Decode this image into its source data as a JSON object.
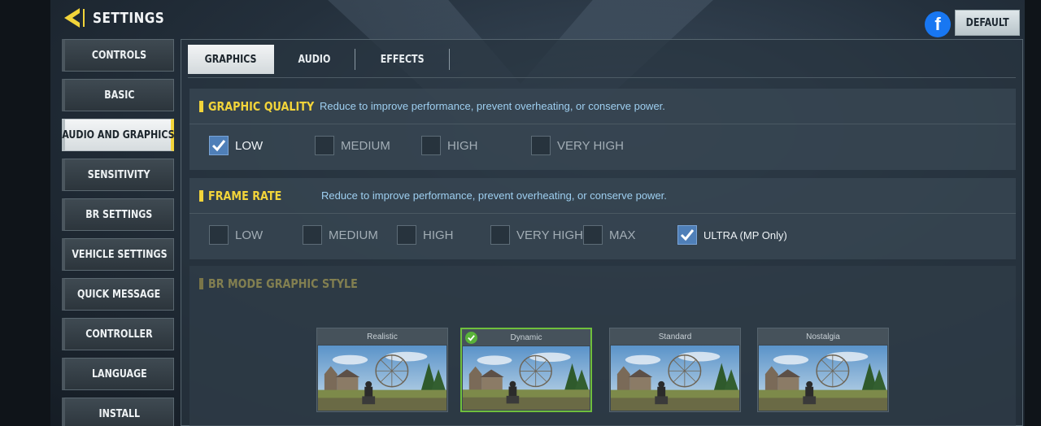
{
  "header": {
    "title": "SETTINGS",
    "back_icon": "back-arrow-icon",
    "default_label": "DEFAULT",
    "facebook_icon": "facebook-icon"
  },
  "sidebar": {
    "items": [
      {
        "label": "CONTROLS"
      },
      {
        "label": "BASIC"
      },
      {
        "label": "AUDIO AND GRAPHICS",
        "active": true
      },
      {
        "label": "SENSITIVITY"
      },
      {
        "label": "BR SETTINGS"
      },
      {
        "label": "VEHICLE SETTINGS"
      },
      {
        "label": "QUICK MESSAGE"
      },
      {
        "label": "CONTROLLER"
      },
      {
        "label": "LANGUAGE"
      },
      {
        "label": "INSTALL"
      }
    ]
  },
  "tabs": [
    {
      "label": "GRAPHICS",
      "active": true
    },
    {
      "label": "AUDIO"
    },
    {
      "label": "EFFECTS"
    }
  ],
  "graphic_quality": {
    "title": "GRAPHIC QUALITY",
    "description": "Reduce to improve performance, prevent overheating, or conserve power.",
    "options": [
      {
        "label": "LOW",
        "checked": true
      },
      {
        "label": "MEDIUM",
        "checked": false
      },
      {
        "label": "HIGH",
        "checked": false
      },
      {
        "label": "VERY HIGH",
        "checked": false
      }
    ]
  },
  "frame_rate": {
    "title": "FRAME RATE",
    "description": "Reduce to improve performance, prevent overheating, or conserve power.",
    "options": [
      {
        "label": "LOW",
        "checked": false
      },
      {
        "label": "MEDIUM",
        "checked": false
      },
      {
        "label": "HIGH",
        "checked": false
      },
      {
        "label": "VERY HIGH",
        "checked": false
      },
      {
        "label": "MAX",
        "checked": false
      },
      {
        "label": "ULTRA (MP Only)",
        "checked": true
      }
    ]
  },
  "br_style": {
    "title": "BR MODE GRAPHIC STYLE",
    "styles": [
      {
        "label": "Realistic",
        "selected": false
      },
      {
        "label": "Dynamic",
        "selected": true
      },
      {
        "label": "Standard",
        "selected": false
      },
      {
        "label": "Nostalgia",
        "selected": false
      }
    ]
  },
  "colors": {
    "accent": "#f2d43a",
    "checkbox_checked": "#4f7fb8",
    "description": "#9ecff0",
    "selected_border": "#6fbf3c",
    "facebook": "#1877f2"
  }
}
